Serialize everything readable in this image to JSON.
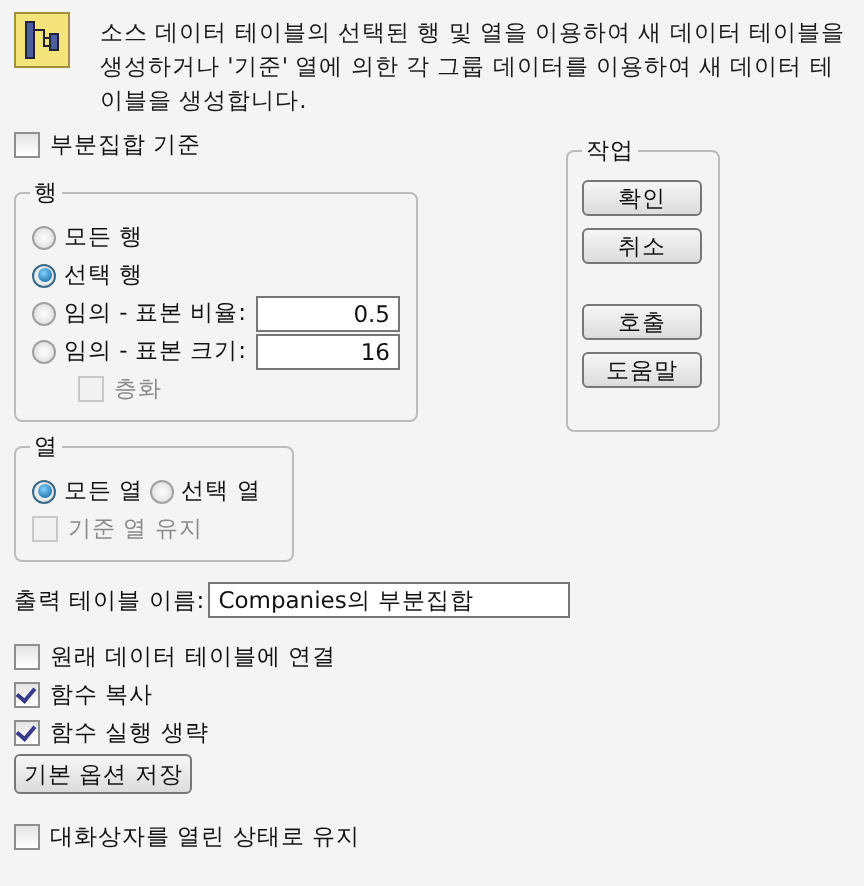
{
  "header": {
    "description": "소스 데이터 테이블의 선택된 행 및 열을 이용하여 새 데이터 테이블을 생성하거나 '기준' 열에 의한 각 그룹 데이터를 이용하여 새 데이터 테이블을 생성합니다."
  },
  "subset_by": {
    "label": "부분집합 기준",
    "checked": false
  },
  "rows_group": {
    "title": "행",
    "options": [
      {
        "label": "모든 행",
        "selected": false
      },
      {
        "label": "선택 행",
        "selected": true
      },
      {
        "label": "임의 - 표본 비율:",
        "selected": false,
        "value": "0.5"
      },
      {
        "label": "임의 - 표본 크기:",
        "selected": false,
        "value": "16"
      }
    ],
    "stratify": {
      "label": "층화",
      "checked": false,
      "disabled": true
    }
  },
  "columns_group": {
    "title": "열",
    "options": [
      {
        "label": "모든 열",
        "selected": true
      },
      {
        "label": "선택 열",
        "selected": false
      }
    ],
    "keep_by_columns": {
      "label": "기준 열 유지",
      "checked": false,
      "disabled": true
    }
  },
  "actions": {
    "title": "작업",
    "button_groups": [
      [
        "확인",
        "취소"
      ],
      [
        "호출",
        "도움말"
      ]
    ]
  },
  "output_table": {
    "label": "출력 테이블 이름:",
    "value": "Companies의 부분집합"
  },
  "options": [
    {
      "label": "원래 데이터 테이블에 연결",
      "checked": false
    },
    {
      "label": "함수 복사",
      "checked": true
    },
    {
      "label": "함수 실행 생략",
      "checked": true
    }
  ],
  "save_button": "기본 옵션 저장",
  "keep_open": {
    "label": "대화상자를 열린 상태로 유지",
    "checked": false
  }
}
